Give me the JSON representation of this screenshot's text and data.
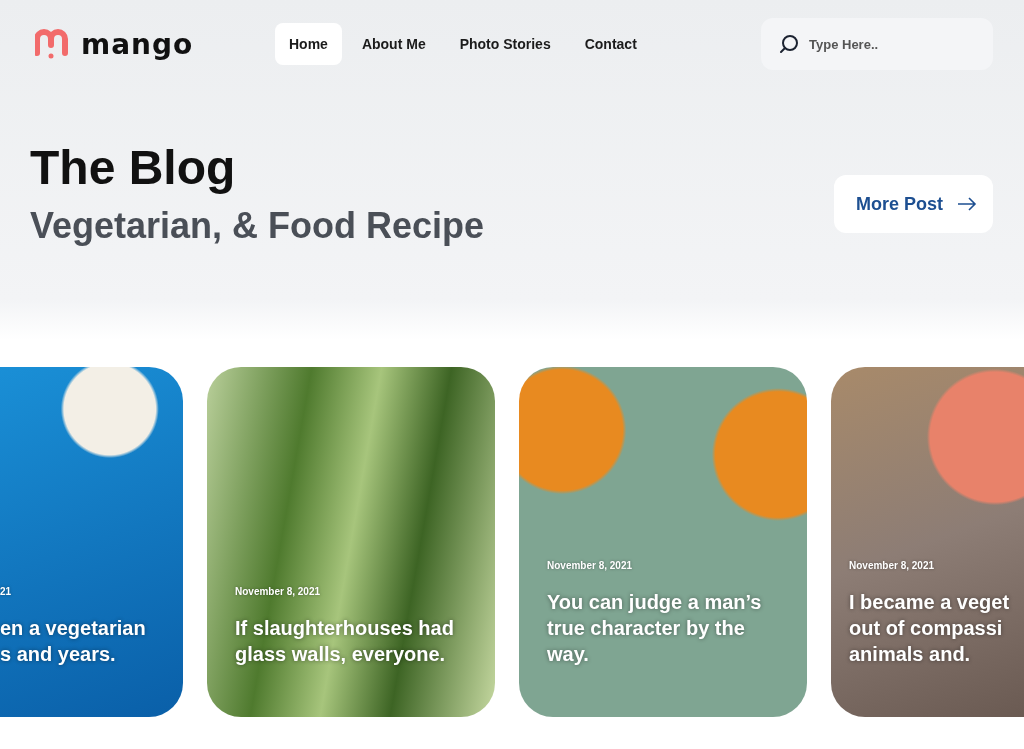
{
  "header": {
    "logo": {
      "text": "mango"
    },
    "nav": [
      {
        "label": "Home",
        "selected": true
      },
      {
        "label": "About Me",
        "selected": false
      },
      {
        "label": "Photo Stories",
        "selected": false
      },
      {
        "label": "Contact",
        "selected": false
      }
    ],
    "search": {
      "placeholder": "Type Here.."
    }
  },
  "hero": {
    "title": "The Blog",
    "subtitle": "Vegetarian, & Food Recipe",
    "button": "More Post"
  },
  "posts": [
    {
      "date": "21",
      "title_lines": [
        "en a vegetarian",
        "s and years."
      ]
    },
    {
      "date": "November 8, 2021",
      "title_lines": [
        "If slaughterhouses had",
        "glass walls, everyone."
      ]
    },
    {
      "date": "November 8, 2021",
      "title_lines": [
        "You can judge a man’s",
        "true character by the",
        "way."
      ]
    },
    {
      "date": "November 8, 2021",
      "title_lines": [
        "I became a veget",
        "out of compassi",
        "animals and."
      ]
    }
  ]
}
